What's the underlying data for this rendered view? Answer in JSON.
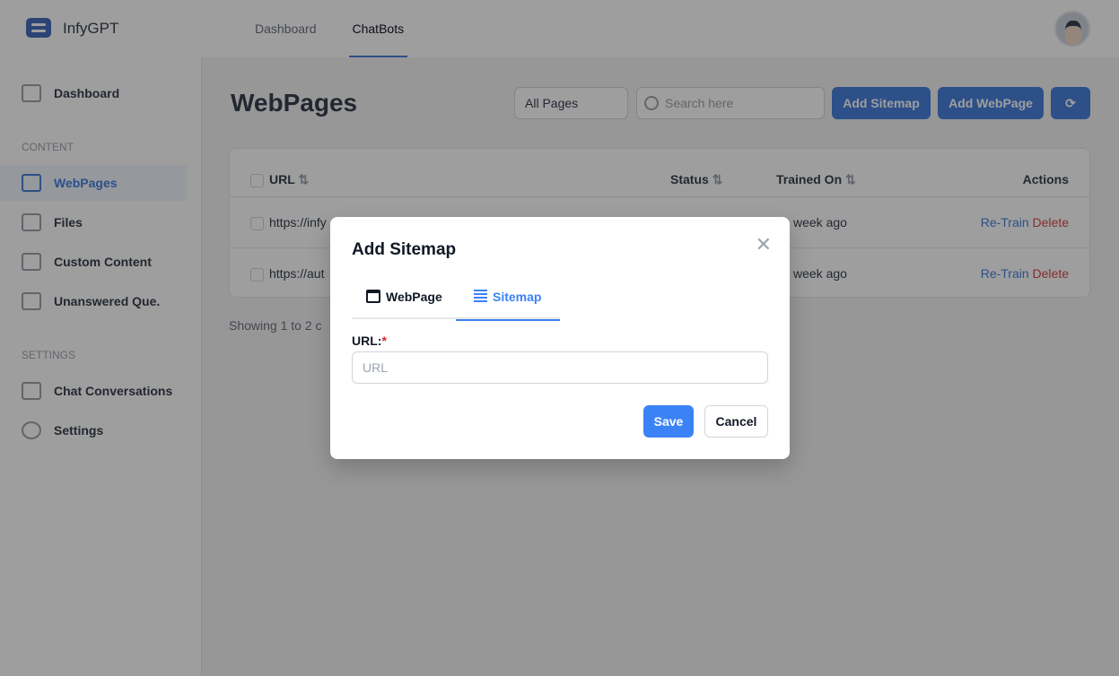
{
  "app": {
    "name": "InfyGPT"
  },
  "topnav": [
    {
      "label": "Dashboard"
    },
    {
      "label": "ChatBots",
      "active": true
    }
  ],
  "sidebar": {
    "dashboard": "Dashboard",
    "content_heading": "CONTENT",
    "settings_heading": "SETTINGS",
    "items": [
      {
        "label": "WebPages",
        "icon": "browser-icon",
        "active": true
      },
      {
        "label": "Files",
        "icon": "file-icon"
      },
      {
        "label": "Custom Content",
        "icon": "book-icon"
      },
      {
        "label": "Unanswered Que.",
        "icon": "chat-question-icon"
      }
    ],
    "settings_items": [
      {
        "label": "Chat Conversations",
        "icon": "chat-icon"
      },
      {
        "label": "Settings",
        "icon": "gear-icon"
      }
    ]
  },
  "page": {
    "title": "WebPages",
    "filter": "All Pages",
    "search_placeholder": "Search here",
    "add_sitemap": "Add Sitemap",
    "add_webpage": "Add WebPage"
  },
  "table": {
    "columns": [
      "URL",
      "Status",
      "Trained On",
      "Actions"
    ],
    "rows": [
      {
        "url": "https://infy",
        "trained": "week ago",
        "retrain": "Re-Train",
        "delete": "Delete"
      },
      {
        "url": "https://aut",
        "trained": "week ago",
        "retrain": "Re-Train",
        "delete": "Delete"
      }
    ]
  },
  "showing": "Showing 1  to 2  c",
  "modal": {
    "title": "Add Sitemap",
    "tabs": [
      "WebPage",
      "Sitemap"
    ],
    "active_tab": "Sitemap",
    "url_label": "URL:",
    "required": "*",
    "url_placeholder": "URL",
    "url_value": "",
    "save": "Save",
    "cancel": "Cancel"
  },
  "colors": {
    "accent": "#3b82f6",
    "danger": "#ef4444"
  }
}
